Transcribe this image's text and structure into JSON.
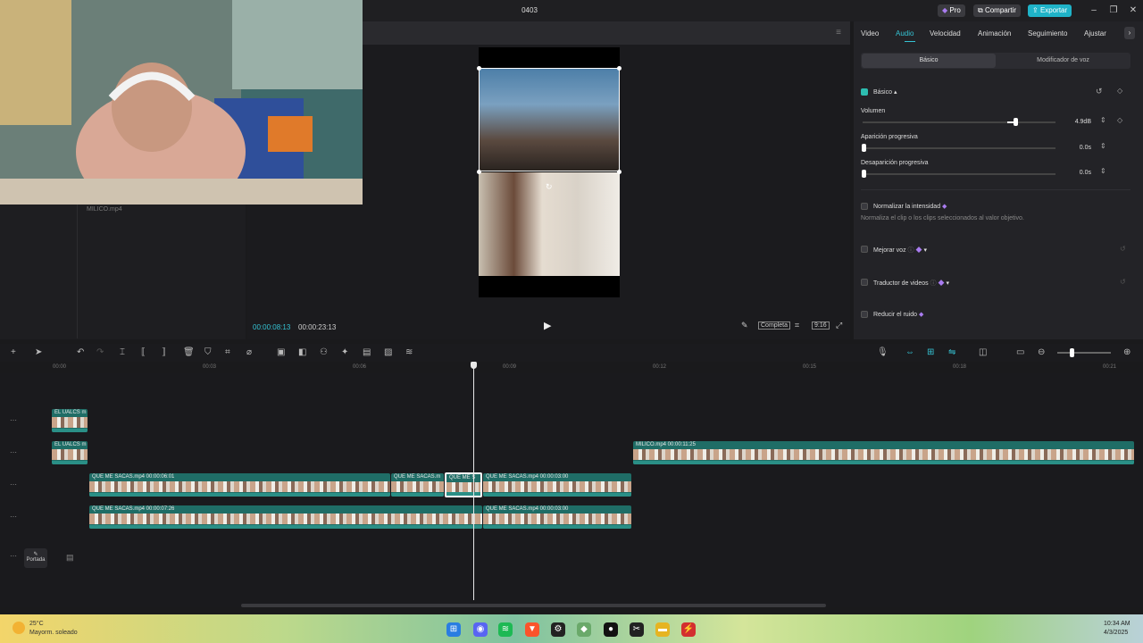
{
  "window": {
    "title": "0403"
  },
  "topbar": {
    "pro": "Pro",
    "share": "Compartir",
    "export": "Exportar"
  },
  "media": {
    "clip_name": "MILICO.mp4"
  },
  "player": {
    "current_time": "00:00:08:13",
    "total_time": "00:00:23:13",
    "fit_label": "Completa",
    "ratio_label": "9:16"
  },
  "props": {
    "tabs": [
      "Video",
      "Audio",
      "Velocidad",
      "Animación",
      "Seguimiento",
      "Ajustar"
    ],
    "active_tab": "Audio",
    "subtabs": [
      "Básico",
      "Modificador de voz"
    ],
    "section": "Básico",
    "volume": {
      "label": "Volumen",
      "value": "4.9dB",
      "level": 0.78
    },
    "fade_in": {
      "label": "Aparición progresiva",
      "value": "0.0s"
    },
    "fade_out": {
      "label": "Desaparición progresiva",
      "value": "0.0s"
    },
    "normalize": {
      "label": "Normalizar la intensidad",
      "desc": "Normaliza el clip o los clips seleccionados al valor objetivo."
    },
    "enhance": {
      "label": "Mejorar voz"
    },
    "translator": {
      "label": "Traductor de videos"
    },
    "noise": {
      "label": "Reducir el ruido"
    }
  },
  "timeline": {
    "ruler": [
      "00:00",
      "00:03",
      "00:06",
      "00:09",
      "00:12",
      "00:15",
      "00:18",
      "00:21"
    ],
    "clips": {
      "small1": "EL UALCS m",
      "small2": "EL UALCS m",
      "milico": "MILICO.mp4   00:00:11:25",
      "q1": "QUE ME SACAS.mp4   00:00:06:01",
      "q2": "QUE ME SACAS.m",
      "q3": "QUE ME S",
      "q4": "QUE ME SACAS.mp4   00:00:03:00",
      "q5": "QUE ME SACAS.mp4   00:00:07:26",
      "q6": "QUE ME SACAS.mp4   00:00:03:00"
    },
    "cover": "Portada"
  },
  "taskbar": {
    "temp": "25°C",
    "weather": "Mayorm. soleado",
    "time": "10:34 AM",
    "date": "4/3/2025"
  }
}
